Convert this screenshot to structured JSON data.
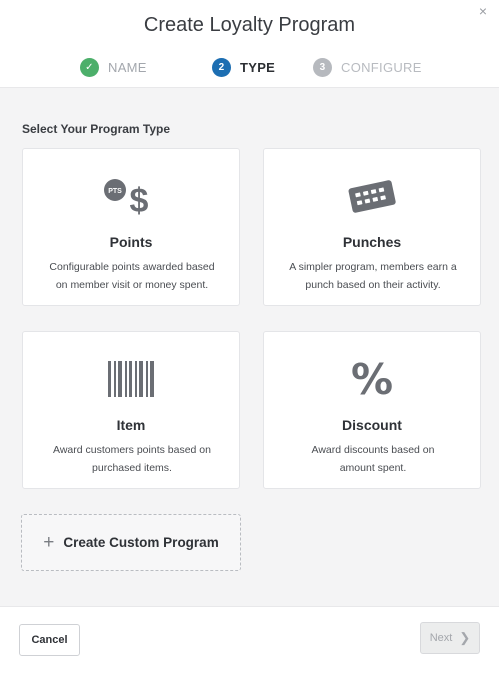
{
  "dialog": {
    "title": "Create Loyalty Program",
    "close_glyph": "×"
  },
  "steps": [
    {
      "number": "✓",
      "label": "NAME",
      "state": "complete"
    },
    {
      "number": "2",
      "label": "TYPE",
      "state": "active"
    },
    {
      "number": "3",
      "label": "CONFIGURE",
      "state": "pending"
    }
  ],
  "section": {
    "label": "Select Your Program Type"
  },
  "cards": {
    "points": {
      "icon": "pts-dollar-icon",
      "icon_badge": "PTS",
      "icon_symbol": "$",
      "title": "Points",
      "desc_line1": "Configurable points awarded based",
      "desc_line2": "on member visit or money spent."
    },
    "punches": {
      "icon": "punch-card-icon",
      "title": "Punches",
      "desc_line1": "A simpler program, members earn a",
      "desc_line2": "punch based on their activity."
    },
    "item": {
      "icon": "barcode-icon",
      "title": "Item",
      "desc_line1": "Award customers points based on",
      "desc_line2": "purchased items."
    },
    "discount": {
      "icon": "percent-icon",
      "icon_symbol": "%",
      "title": "Discount",
      "desc_line1": "Award discounts based on",
      "desc_line2": "amount spent."
    }
  },
  "custom": {
    "plus": "+",
    "label": "Create Custom Program"
  },
  "footer": {
    "cancel_label": "Cancel",
    "next_label": "Next",
    "next_chevron": "❯"
  },
  "colors": {
    "accent_blue": "#1c6eb2",
    "success_green": "#4caf6a",
    "icon_gray": "#6b6e74"
  }
}
